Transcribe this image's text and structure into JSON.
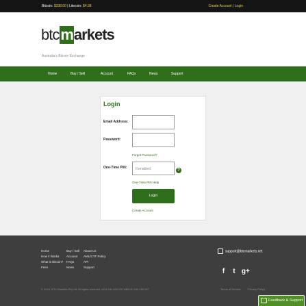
{
  "topbar": {
    "bitcoin_label": "Bitcoin:",
    "bitcoin_value": "$338.00",
    "litecoin_label": "Litecoin:",
    "litecoin_value": "$4.08",
    "create_account": "Create Account",
    "login": "Login"
  },
  "header": {
    "logo_btc": "btc",
    "logo_m": "m",
    "logo_arkets": "arkets",
    "tagline": "Australia's Bitcoin Exchange"
  },
  "nav": {
    "items": [
      "Home",
      "Buy / Sell",
      "Account",
      "FAQs",
      "News",
      "Support"
    ]
  },
  "login": {
    "title": "Login",
    "email_label": "Email Address:",
    "password_label": "Password:",
    "forgot_password": "Forgot Password?",
    "otp_label": "One-Time PIN:",
    "otp_placeholder": "If enabled",
    "otp_help": "One-Time PIN Help",
    "help_glyph": "?",
    "login_button": "Login",
    "create_account": "Create Account"
  },
  "footer": {
    "col1": [
      "Home",
      "How it Works",
      "What is Bitcoin?",
      "Fees"
    ],
    "col2": [
      "Buy / Sell",
      "Account",
      "FAQs",
      "News"
    ],
    "col3": [
      "About Us",
      "AML/CTF Policy",
      "API",
      "Support"
    ],
    "copyright": "© 2015, BTC Markets Pty Ltd. All rights reserved. ACN 164 000 007 ABN 40 164 000 007",
    "terms": "Terms of Service",
    "privacy": "Privacy Policy",
    "support_email": "support@btcmarkets.net",
    "social": [
      "f",
      "t",
      "g+"
    ]
  },
  "feedback": {
    "label": "Feedback & Support"
  }
}
